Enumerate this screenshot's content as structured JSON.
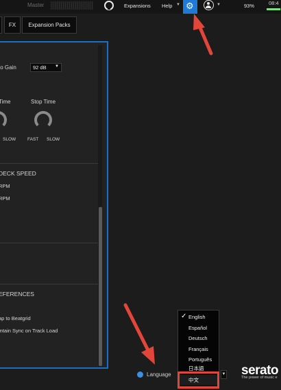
{
  "topbar": {
    "master_label": "Master",
    "expansions_label": "Expansions",
    "help_label": "Help",
    "battery": "93%",
    "clock": "08:4",
    "battery_level": 0.93
  },
  "tabs": [
    {
      "label": ""
    },
    {
      "label": "FX"
    },
    {
      "label": "Expansion Packs"
    }
  ],
  "panel": {
    "auto_gain_label": "to Gain",
    "auto_gain_value": "92 dB",
    "start_time_label": "Time",
    "stop_time_label": "Stop Time",
    "start_slow": "SLOW",
    "stop_fast": "FAST",
    "stop_slow": "SLOW",
    "deck_speed_heading": "DECK SPEED",
    "rpm_1": "RPM",
    "rpm_2": "RPM",
    "preferences_heading": "EFERENCES",
    "snap_label": "ap to Beatgrid",
    "sync_label": "intain Sync on Track Load"
  },
  "language": {
    "label": "Language",
    "options": [
      "English",
      "Español",
      "Deutsch",
      "Français",
      "Português",
      "日本語",
      "中文"
    ],
    "checked": "English",
    "hovered": "中文"
  },
  "brand": {
    "name": "serato",
    "tagline": "The power of music e"
  },
  "colors": {
    "accent": "#1f79d9",
    "annotation": "#e2453a"
  }
}
